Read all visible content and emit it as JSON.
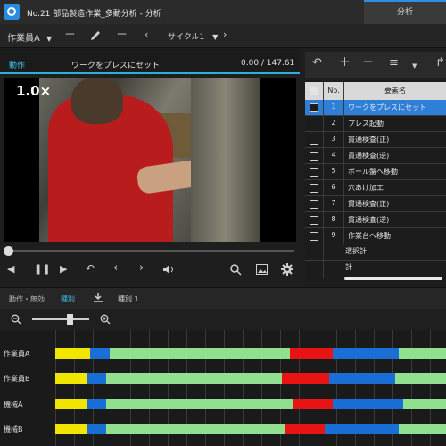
{
  "window": {
    "title": "No.21 部品製造作業_多動分析 - 分析",
    "tab": "分析"
  },
  "toolbar": {
    "worker_select": "作業員A",
    "cycle_select": "サイクル1",
    "add_icon": "plus-icon",
    "edit_icon": "pencil-icon",
    "remove_icon": "minus-icon"
  },
  "motion": {
    "label": "動作",
    "element_name": "ワークをプレスにセット",
    "time": "0.00 / 147.61",
    "speed": "1.0×"
  },
  "player": {
    "progress": 0.0
  },
  "element_table": {
    "header_no": "No.",
    "header_name": "要素名",
    "rows": [
      {
        "no": "1",
        "name": "ワークをプレスにセット",
        "selected": true
      },
      {
        "no": "2",
        "name": "プレス起動",
        "selected": false
      },
      {
        "no": "3",
        "name": "貫通検査(正)",
        "selected": false
      },
      {
        "no": "4",
        "name": "貫通検査(逆)",
        "selected": false
      },
      {
        "no": "5",
        "name": "ボール盤へ移動",
        "selected": false
      },
      {
        "no": "6",
        "name": "穴あけ加工",
        "selected": false
      },
      {
        "no": "7",
        "name": "貫通検査(正)",
        "selected": false
      },
      {
        "no": "8",
        "name": "貫通検査(逆)",
        "selected": false
      },
      {
        "no": "9",
        "name": "作業台へ移動",
        "selected": false
      }
    ],
    "subtotal_label": "選択計",
    "total_label": "計"
  },
  "bottom": {
    "tab_motion": "動作・無効",
    "tab_type": "種別",
    "type_label": "種別 1",
    "zoom_level": 0.65
  },
  "timeline": {
    "lanes": [
      {
        "label": "作業員A",
        "segments": [
          {
            "color": "#f2e600",
            "start": 0.0,
            "end": 0.09
          },
          {
            "color": "#1a6fd6",
            "start": 0.09,
            "end": 0.14
          },
          {
            "color": "#90e090",
            "start": 0.14,
            "end": 0.6
          },
          {
            "color": "#e81414",
            "start": 0.6,
            "end": 0.71
          },
          {
            "color": "#1a6fd6",
            "start": 0.71,
            "end": 0.88
          },
          {
            "color": "#90e090",
            "start": 0.88,
            "end": 1.0
          }
        ]
      },
      {
        "label": "作業員B",
        "segments": [
          {
            "color": "#f2e600",
            "start": 0.0,
            "end": 0.08
          },
          {
            "color": "#1a6fd6",
            "start": 0.08,
            "end": 0.13
          },
          {
            "color": "#90e090",
            "start": 0.13,
            "end": 0.58
          },
          {
            "color": "#e81414",
            "start": 0.58,
            "end": 0.7
          },
          {
            "color": "#1a6fd6",
            "start": 0.7,
            "end": 0.87
          },
          {
            "color": "#90e090",
            "start": 0.87,
            "end": 1.0
          }
        ]
      },
      {
        "label": "機械A",
        "segments": [
          {
            "color": "#f2e600",
            "start": 0.0,
            "end": 0.08
          },
          {
            "color": "#1a6fd6",
            "start": 0.08,
            "end": 0.13
          },
          {
            "color": "#90e090",
            "start": 0.13,
            "end": 0.61
          },
          {
            "color": "#e81414",
            "start": 0.61,
            "end": 0.71
          },
          {
            "color": "#1a6fd6",
            "start": 0.71,
            "end": 0.89
          },
          {
            "color": "#90e090",
            "start": 0.89,
            "end": 1.0
          }
        ]
      },
      {
        "label": "機械B",
        "segments": [
          {
            "color": "#f2e600",
            "start": 0.0,
            "end": 0.08
          },
          {
            "color": "#1a6fd6",
            "start": 0.08,
            "end": 0.13
          },
          {
            "color": "#90e090",
            "start": 0.13,
            "end": 0.59
          },
          {
            "color": "#e81414",
            "start": 0.59,
            "end": 0.69
          },
          {
            "color": "#1a6fd6",
            "start": 0.69,
            "end": 0.88
          },
          {
            "color": "#90e090",
            "start": 0.88,
            "end": 1.0
          }
        ]
      }
    ]
  }
}
